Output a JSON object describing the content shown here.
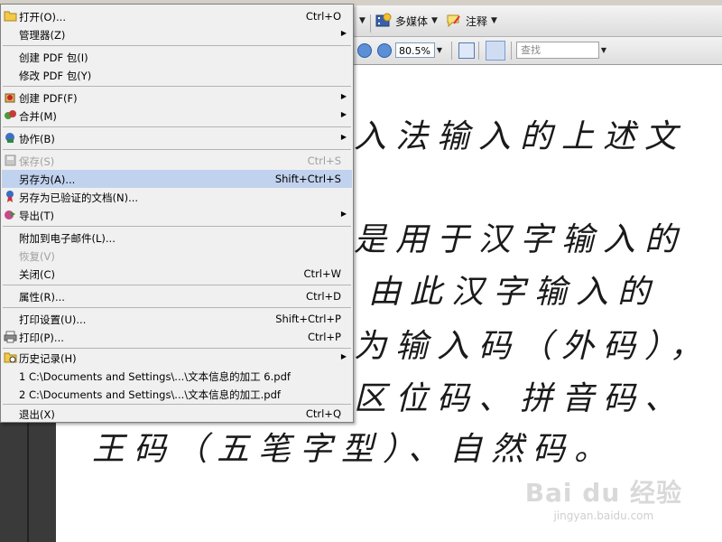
{
  "toolbar": {
    "multimedia_label": "多媒体",
    "comment_label": "注释",
    "zoom_value": "80.5%",
    "find_placeholder": "查找"
  },
  "document": {
    "lines": [
      "入法输入的上述文",
      "是用于汉字输入的",
      "，由此汉字输入的",
      "为输入码（外码），",
      "区位码、拼音码、",
      "王码（五笔字型）、自然码。"
    ]
  },
  "watermark": {
    "main": "Bai du 经验",
    "sub": "jingyan.baidu.com"
  },
  "menu": {
    "items": [
      {
        "label": "打开(O)...",
        "shortcut": "Ctrl+O",
        "icon": "folder-open-icon"
      },
      {
        "label": "管理器(Z)",
        "submenu": "▶"
      },
      {
        "label": "创建 PDF 包(I)"
      },
      {
        "label": "修改 PDF 包(Y)"
      },
      {
        "label": "创建 PDF(F)",
        "submenu": "▶",
        "icon": "create-pdf-icon"
      },
      {
        "label": "合并(M)",
        "submenu": "▶",
        "icon": "combine-icon"
      },
      {
        "label": "协作(B)",
        "submenu": "▶",
        "icon": "collaborate-icon"
      },
      {
        "label": "保存(S)",
        "shortcut": "Ctrl+S",
        "icon": "save-icon"
      },
      {
        "label": "另存为(A)...",
        "shortcut": "Shift+Ctrl+S"
      },
      {
        "label": "另存为已验证的文档(N)...",
        "icon": "certified-ribbon-icon"
      },
      {
        "label": "导出(T)",
        "submenu": "▶",
        "icon": "export-icon"
      },
      {
        "label": "附加到电子邮件(L)..."
      },
      {
        "label": "恢复(V)"
      },
      {
        "label": "关闭(C)",
        "shortcut": "Ctrl+W"
      },
      {
        "label": "属性(R)...",
        "shortcut": "Ctrl+D"
      },
      {
        "label": "打印设置(U)...",
        "shortcut": "Shift+Ctrl+P"
      },
      {
        "label": "打印(P)...",
        "shortcut": "Ctrl+P",
        "icon": "printer-icon"
      },
      {
        "label": "历史记录(H)",
        "submenu": "▶",
        "icon": "history-icon"
      },
      {
        "label": "1 C:\\Documents and Settings\\...\\文本信息的加工 6.pdf"
      },
      {
        "label": "2 C:\\Documents and Settings\\...\\文本信息的加工.pdf"
      },
      {
        "label": "退出(X)",
        "shortcut": "Ctrl+Q"
      }
    ]
  },
  "colors": {
    "highlight": "#c1d2ee",
    "menu_bg": "#f0f0f0",
    "nav_pane": "#3a3a3a"
  }
}
